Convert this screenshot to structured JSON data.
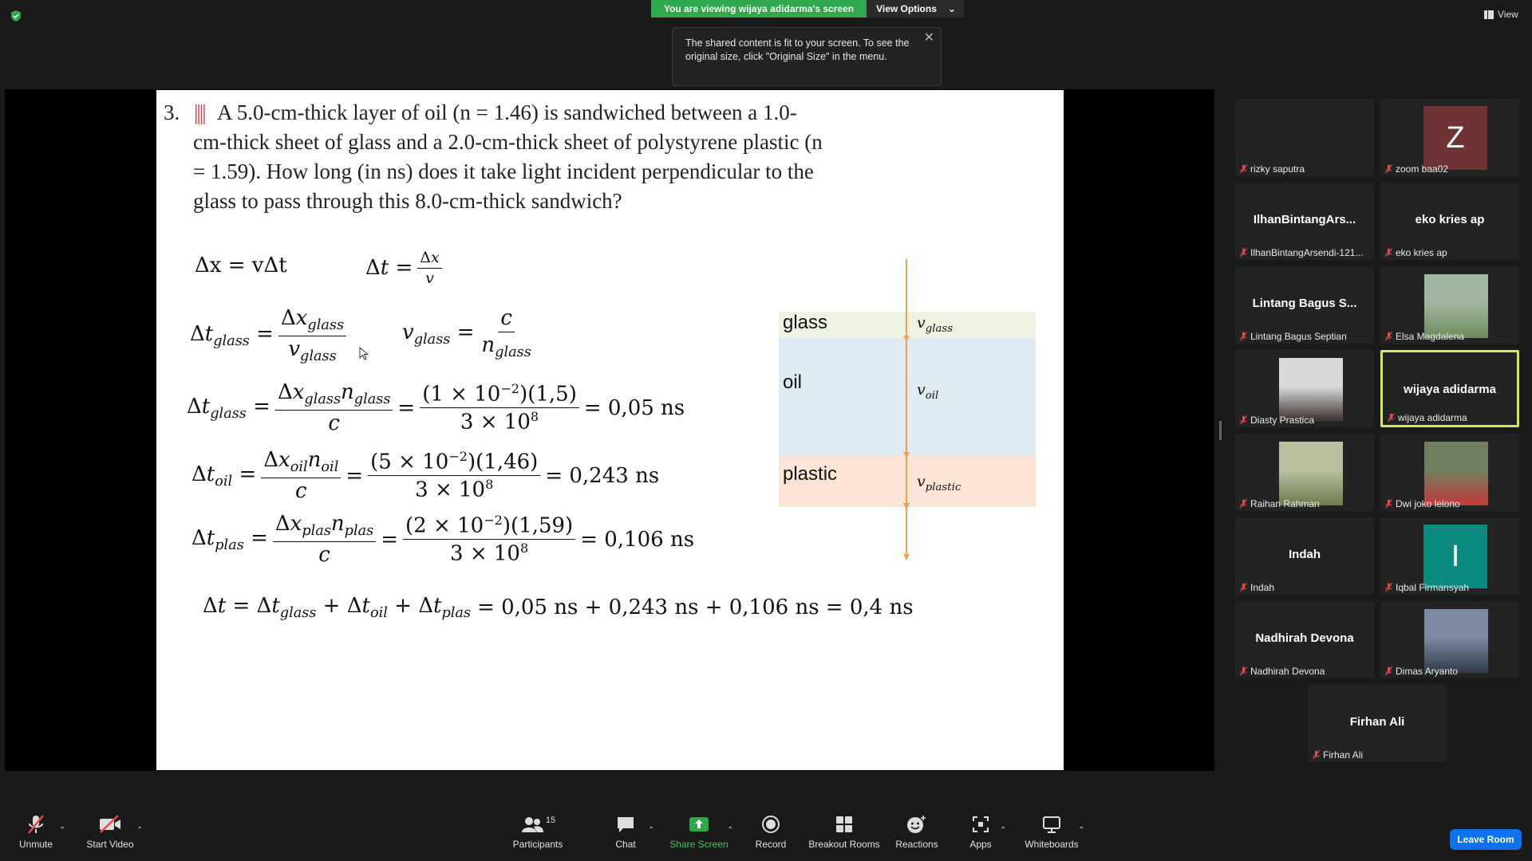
{
  "topbar": {
    "banner_text": "You are viewing wijaya adidarma's screen",
    "view_options": "View Options",
    "tooltip": "The shared content is fit to your screen. To see the original size, click \"Original Size\" in the menu.",
    "view_label": "View"
  },
  "slide": {
    "number": "3.",
    "bars": "||||",
    "problem": "A 5.0-cm-thick layer of oil (n = 1.46) is sandwiched between a 1.0-cm-thick sheet of glass and a 2.0-cm-thick sheet of polystyrene plastic (n = 1.59). How long (in ns) does it take light incident perpendicular to the glass to pass through this 8.0-cm-thick sandwich?",
    "eq1_left": "Δx = vΔt",
    "eq_glass_result": "= 0,05 ns",
    "eq_oil_result": "= 0,243 ns",
    "eq_plas_result": "= 0,106 ns",
    "total_result": "= 0,05 ns + 0,243 ns + 0,106 ns = 0,4 ns",
    "glass_values": "(1 × 10",
    "glass_exp": "−2",
    "glass_n": ")(1,5)",
    "oil_values": "(5 × 10",
    "oil_n": ")(1,46)",
    "plas_values": "(2 × 10",
    "plas_n": ")(1,59)",
    "c_denominator": "3 × 10",
    "c_exp": "8",
    "diagram": {
      "glass_label": "glass",
      "oil_label": "oil",
      "plastic_label": "plastic",
      "glass_color": "#eef2e1",
      "oil_color": "#deebf3",
      "plastic_color": "#fce4d6",
      "arrow_color": "#f0a050"
    }
  },
  "participants": [
    {
      "id": "rizky",
      "name": "rizky saputra",
      "display": "",
      "type": "blank"
    },
    {
      "id": "zoom",
      "name": "zoom baa02",
      "display": "Z",
      "type": "avatar",
      "color": "#6e3434"
    },
    {
      "id": "ilhan",
      "name": "IlhanBintangArsendi-121...",
      "display": "IlhanBintangArs...",
      "type": "text"
    },
    {
      "id": "eko",
      "name": "eko kries ap",
      "display": "eko kries ap",
      "type": "text"
    },
    {
      "id": "lintang",
      "name": "Lintang Bagus Septian",
      "display": "Lintang Bagus S...",
      "type": "text"
    },
    {
      "id": "elsa",
      "name": "Elsa Magdalena",
      "display": "",
      "type": "photo"
    },
    {
      "id": "diasty",
      "name": "Diasty Prastica",
      "display": "",
      "type": "photo"
    },
    {
      "id": "wijaya",
      "name": "wijaya adidarma",
      "display": "wijaya adidarma",
      "type": "text"
    },
    {
      "id": "raihan",
      "name": "Raihan Rahman",
      "display": "",
      "type": "photo"
    },
    {
      "id": "dwi",
      "name": "Dwi joko lelono",
      "display": "",
      "type": "photo"
    },
    {
      "id": "indah",
      "name": "Indah",
      "display": "Indah",
      "type": "text"
    },
    {
      "id": "iqbal",
      "name": "Iqbal Firmansyah",
      "display": "I",
      "type": "avatar",
      "color": "#0c8a80"
    },
    {
      "id": "nadhirah",
      "name": "Nadhirah Devona",
      "display": "Nadhirah Devona",
      "type": "text"
    },
    {
      "id": "dimas",
      "name": "Dimas Aryanto",
      "display": "",
      "type": "photo"
    },
    {
      "id": "firhan",
      "name": "Firhan Ali",
      "display": "Firhan Ali",
      "type": "text"
    }
  ],
  "toolbar": {
    "unmute": "Unmute",
    "start_video": "Start Video",
    "participants": "Participants",
    "participants_count": "15",
    "chat": "Chat",
    "share_screen": "Share Screen",
    "record": "Record",
    "breakout_rooms": "Breakout Rooms",
    "reactions": "Reactions",
    "apps": "Apps",
    "whiteboards": "Whiteboards",
    "leave_room": "Leave Room"
  }
}
